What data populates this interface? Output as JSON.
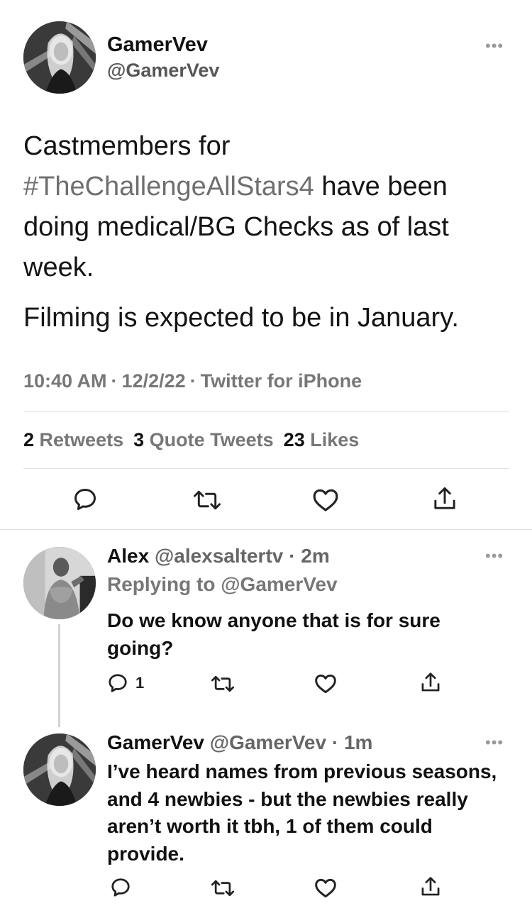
{
  "main_tweet": {
    "display_name": "GamerVev",
    "handle": "@GamerVev",
    "more_icon": "more-horizontal-icon",
    "text_line1_before": "Castmembers for",
    "hashtag": "#TheChallengeAllStars4",
    "text_line2_after": " have been",
    "text_rest": "doing medical/BG Checks as of last week.",
    "text_paragraph2": "Filming is expected to be in January.",
    "time": "10:40 AM",
    "date": "12/2/22",
    "source": "Twitter for iPhone",
    "sep": "·",
    "stats": {
      "retweets_count": "2",
      "retweets_label": "Retweets",
      "quotes_count": "3",
      "quotes_label": "Quote Tweets",
      "likes_count": "23",
      "likes_label": "Likes"
    },
    "actions": [
      "reply-icon",
      "retweet-icon",
      "like-icon",
      "share-icon"
    ]
  },
  "replies": [
    {
      "display_name": "Alex",
      "handle": "@alexsaltertv",
      "sep": "·",
      "age": "2m",
      "replying_prefix": "Replying to",
      "replying_to": "@GamerVev",
      "text": "Do we know anyone that is for sure going?",
      "reply_count": "1"
    },
    {
      "display_name": "GamerVev",
      "handle": "@GamerVev",
      "sep": "·",
      "age": "1m",
      "text": "I’ve heard names from previous seasons, and 4 newbies - but the newbies really aren’t worth it tbh, 1 of them could provide."
    }
  ],
  "colors": {
    "text": "#141414",
    "muted": "#777777",
    "hashtag": "#6f6f6f",
    "divider": "#e1e1e1"
  }
}
